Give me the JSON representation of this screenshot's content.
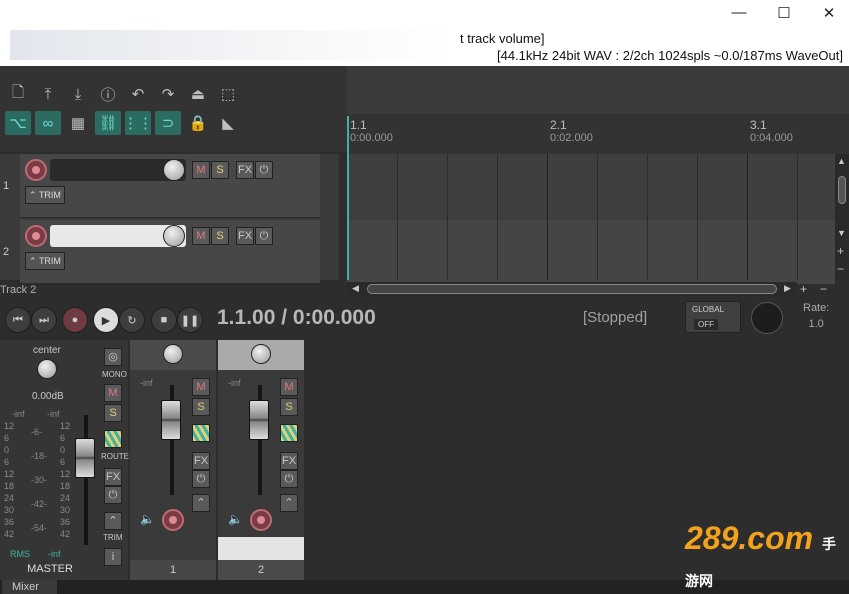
{
  "window": {
    "title_suffix": "t track volume]",
    "status": "[44.1kHz 24bit WAV : 2/2ch 1024spls ~0.0/187ms WaveOut]",
    "min": "—",
    "max": "☐",
    "close": "✕"
  },
  "toolbar": {
    "row1": [
      "new-file-icon",
      "save-upload-icon",
      "save-download-icon",
      "info-icon",
      "undo-icon",
      "redo-icon",
      "metronome-icon",
      "grid-icon"
    ],
    "row2": [
      "ripple-icon",
      "link-icon",
      "snap-icon",
      "grouping-icon",
      "grid-lines-icon",
      "loop-icon",
      "lock-icon",
      "envelope-icon"
    ]
  },
  "ruler": {
    "markers": [
      {
        "bar": "1.1",
        "time": "0:00.000"
      },
      {
        "bar": "2.1",
        "time": "0:02.000"
      },
      {
        "bar": "3.1",
        "time": "0:04.000"
      }
    ]
  },
  "tracks": [
    {
      "num": "1",
      "mute": "M",
      "solo": "S",
      "fx": "FX",
      "trim": "TRIM"
    },
    {
      "num": "2",
      "mute": "M",
      "solo": "S",
      "fx": "FX",
      "trim": "TRIM"
    }
  ],
  "transport": {
    "track_label": "Track 2",
    "time": "1.1.00 / 0:00.000",
    "state": "[Stopped]",
    "global": "GLOBAL",
    "global_val": "OFF",
    "rate_label": "Rate:",
    "rate_val": "1.0"
  },
  "master": {
    "pan": "center",
    "vol": "0.00dB",
    "peakL": "-inf",
    "peakR": "-inf",
    "rms": "RMS",
    "rms_val": "-inf",
    "label": "MASTER",
    "mono": "MONO",
    "route": "ROUTE",
    "trim": "TRIM",
    "mute": "M",
    "solo": "S",
    "fx": "FX",
    "info": "i",
    "scaleL": [
      "12",
      "6",
      "0",
      "6",
      "12",
      "18",
      "24",
      "30",
      "36",
      "42"
    ],
    "scaleM": [
      "-6-",
      "-18-",
      "-30-",
      "-42-",
      "-54-"
    ],
    "scaleR": [
      "12",
      "6",
      "0",
      "6",
      "12",
      "18",
      "24",
      "30",
      "36",
      "42"
    ]
  },
  "strips": [
    {
      "num": "1",
      "peak": "-inf",
      "mute": "M",
      "solo": "S",
      "fx": "FX"
    },
    {
      "num": "2",
      "peak": "-inf",
      "mute": "M",
      "solo": "S",
      "fx": "FX"
    }
  ],
  "tabs": {
    "mixer": "Mixer"
  },
  "watermark": {
    "main": "289.com",
    "sub": "手游网"
  }
}
